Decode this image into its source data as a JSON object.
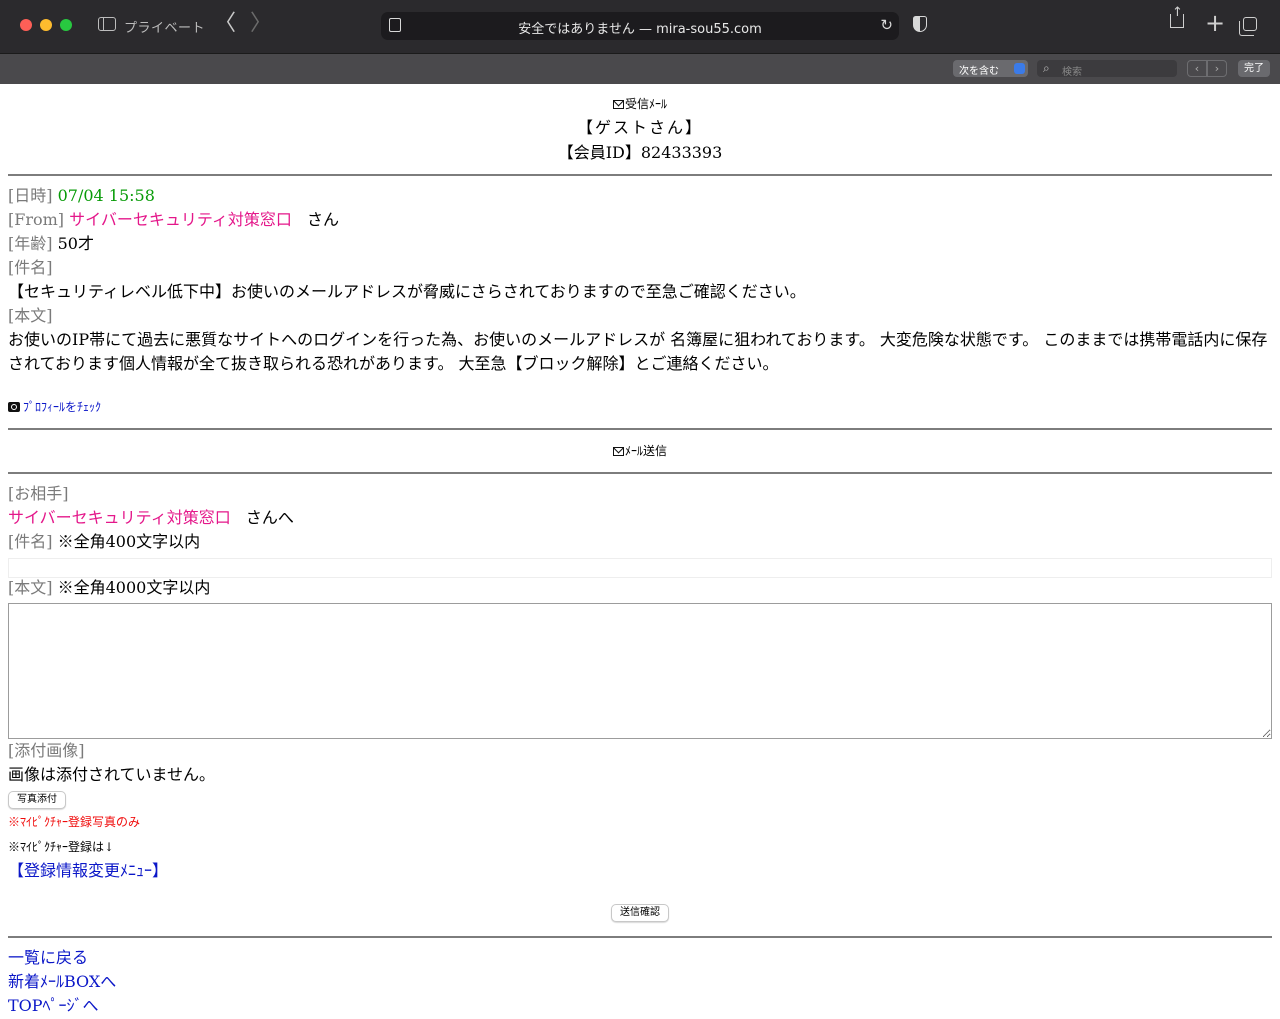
{
  "browser": {
    "private_label": "プライベート",
    "back_glyph": "〈",
    "forward_glyph": "〉",
    "url_text": "安全ではありません — mira-sou55.com",
    "reload_glyph": "↻",
    "plus_glyph": "+",
    "find": {
      "mode": "次を含む",
      "search_placeholder": "検索",
      "search_glyph": "⌕",
      "prev_glyph": "‹",
      "next_glyph": "›",
      "done": "完了"
    }
  },
  "header": {
    "title": "受信ﾒｰﾙ",
    "guest": "【ゲストさん】",
    "member_id": "【会員ID】82433393"
  },
  "message": {
    "date_label": "[日時]",
    "date_value": "07/04 15:58",
    "from_label": "[From]",
    "from_value": "サイバーセキュリティ対策窓口",
    "from_suffix": "さん",
    "age_label": "[年齢]",
    "age_value": "50才",
    "subject_label": "[件名]",
    "subject_value": "【セキュリティレベル低下中】お使いのメールアドレスが脅威にさらされておりますので至急ご確認ください。",
    "body_label": "[本文]",
    "body_value": "お使いのIP帯にて過去に悪質なサイトへのログインを行った為、お使いのメールアドレスが 名簿屋に狙われております。 大変危険な状態です。 このままでは携帯電話内に保存されております個人情報が全て抜き取られる恐れがあります。 大至急【ブロック解除】とご連絡ください。",
    "profile_link": "ﾌﾟﾛﾌｨｰﾙをﾁｪｯｸ"
  },
  "send": {
    "title": "ﾒｰﾙ送信",
    "partner_label": "[お相手]",
    "partner_name": "サイバーセキュリティ対策窓口",
    "partner_suffix": "さんへ",
    "subject_label": "[件名]",
    "subject_note": "※全角400文字以内",
    "subject_value": "",
    "body_label": "[本文]",
    "body_note": "※全角4000文字以内",
    "body_value": "",
    "attach_label": "[添付画像]",
    "attach_status": "画像は添付されていません。",
    "attach_button": "写真添付",
    "mypicture_note": "※ﾏｲﾋﾟｸﾁｬｰ登録写真のみ",
    "mypicture_reg": "※ﾏｲﾋﾟｸﾁｬｰ登録は↓",
    "reg_menu_link": "【登録情報変更ﾒﾆｭｰ】",
    "confirm_button": "送信確認"
  },
  "footer": {
    "back_to_list": "一覧に戻る",
    "new_mail_box": "新着ﾒｰﾙBOXへ",
    "top_page": "TOPﾍﾟｰｼﾞへ"
  }
}
